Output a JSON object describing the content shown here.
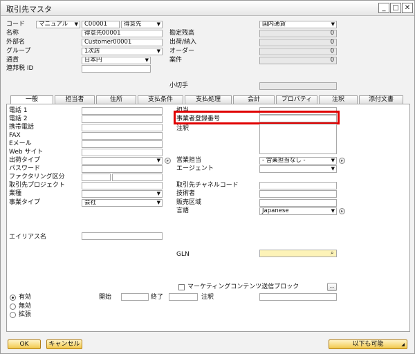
{
  "window": {
    "title": "取引先マスタ",
    "minimize": "_",
    "maximize": "□",
    "close": "✕"
  },
  "header": {
    "code_label": "コード",
    "code_series": "マニュアル",
    "code_value": "C00001",
    "type_value": "得意先",
    "name_label": "名称",
    "name_value": "得意先00001",
    "foreign_name_label": "外部名",
    "foreign_name_value": "Customer00001",
    "group_label": "グループ",
    "group_value": "1次店",
    "currency_label": "通貨",
    "currency_value": "日本円",
    "federal_tax_label": "連邦税 ID",
    "local_currency": "国内通貨",
    "balance_label": "勘定残高",
    "balance_value": "0",
    "deliveries_label": "出荷/納入",
    "deliveries_value": "0",
    "orders_label": "オーダー",
    "orders_value": "0",
    "opportunities_label": "案件",
    "opportunities_value": "0",
    "checks_label": "小切手"
  },
  "tabs": [
    "一般",
    "担当者",
    "住所",
    "支払条件",
    "支払処理",
    "会計",
    "プロパティ",
    "注釈",
    "添付文書"
  ],
  "general": {
    "tel1_label": "電話 1",
    "tel2_label": "電話 2",
    "mobile_label": "携帯電話",
    "fax_label": "FAX",
    "email_label": "Eメール",
    "website_label": "Web サイト",
    "shipping_type_label": "出荷タイプ",
    "password_label": "パスワード",
    "factoring_label": "ファクタリング区分",
    "bp_project_label": "取引先プロジェクト",
    "industry_label": "業種",
    "business_type_label": "事業タイプ",
    "business_type_value": "会社",
    "alias_label": "エイリアス名",
    "contact_label": "担当",
    "reg_number_label": "事業者登録番号",
    "remarks_label": "注釈",
    "sales_employee_label": "営業担当",
    "sales_employee_value": "- 営業担当なし -",
    "agent_label": "エージェント",
    "channel_code_label": "取引先チャネルコード",
    "technician_label": "技術者",
    "territory_label": "販売区域",
    "language_label": "言語",
    "language_value": "Japanese",
    "gln_label": "GLN",
    "marketing_block_label": "マーケティングコンテンツ送信ブロック",
    "from_label": "開始",
    "to_label": "終了",
    "remarks2_label": "注釈",
    "active_label": "有効",
    "inactive_label": "無効",
    "advanced_label": "拡張",
    "ellipsis": "..."
  },
  "footer": {
    "ok": "OK",
    "cancel": "キャンセル",
    "also_possible": "以下も可能"
  }
}
